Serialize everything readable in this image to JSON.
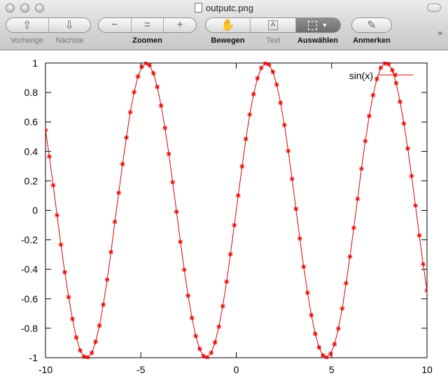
{
  "window": {
    "title": "outputc.png"
  },
  "toolbar": {
    "prev_label": "Vorherige",
    "next_label": "Nächste",
    "zoom_label": "Zoomen",
    "move_label": "Bewegen",
    "text_label": "Text",
    "select_label": "Auswählen",
    "annotate_label": "Anmerken",
    "overflow": "»"
  },
  "chart_data": {
    "type": "line",
    "function": "sin(x)",
    "x": [
      -10.0,
      -9.798,
      -9.596,
      -9.394,
      -9.192,
      -8.99,
      -8.788,
      -8.586,
      -8.384,
      -8.182,
      -7.98,
      -7.778,
      -7.576,
      -7.374,
      -7.172,
      -6.97,
      -6.768,
      -6.566,
      -6.364,
      -6.162,
      -5.96,
      -5.758,
      -5.556,
      -5.354,
      -5.152,
      -4.949,
      -4.747,
      -4.545,
      -4.343,
      -4.141,
      -3.939,
      -3.737,
      -3.535,
      -3.333,
      -3.131,
      -2.929,
      -2.727,
      -2.525,
      -2.323,
      -2.121,
      -1.919,
      -1.717,
      -1.515,
      -1.313,
      -1.111,
      -0.909,
      -0.707,
      -0.505,
      -0.303,
      -0.101,
      0.101,
      0.303,
      0.505,
      0.707,
      0.909,
      1.111,
      1.313,
      1.515,
      1.717,
      1.919,
      2.121,
      2.323,
      2.525,
      2.727,
      2.929,
      3.131,
      3.333,
      3.535,
      3.737,
      3.939,
      4.141,
      4.343,
      4.545,
      4.747,
      4.949,
      5.152,
      5.354,
      5.556,
      5.758,
      5.96,
      6.162,
      6.364,
      6.566,
      6.768,
      6.97,
      7.172,
      7.374,
      7.576,
      7.778,
      7.98,
      8.182,
      8.384,
      8.586,
      8.788,
      8.99,
      9.192,
      9.394,
      9.596,
      9.798,
      10.0
    ],
    "y": [
      0.544,
      0.365,
      0.17,
      -0.033,
      -0.233,
      -0.42,
      -0.589,
      -0.737,
      -0.863,
      -0.951,
      -0.993,
      -0.998,
      -0.968,
      -0.892,
      -0.782,
      -0.64,
      -0.47,
      -0.283,
      -0.078,
      0.119,
      0.314,
      0.494,
      0.666,
      0.802,
      0.908,
      0.974,
      0.999,
      0.985,
      0.93,
      0.838,
      0.711,
      0.559,
      0.383,
      0.191,
      -0.01,
      -0.213,
      -0.403,
      -0.579,
      -0.73,
      -0.853,
      -0.94,
      -0.989,
      -0.998,
      -0.967,
      -0.896,
      -0.789,
      -0.65,
      -0.484,
      -0.298,
      -0.101,
      0.101,
      0.298,
      0.484,
      0.65,
      0.789,
      0.896,
      0.967,
      0.998,
      0.989,
      0.94,
      0.853,
      0.73,
      0.579,
      0.403,
      0.213,
      0.01,
      -0.191,
      -0.383,
      -0.559,
      -0.711,
      -0.838,
      -0.93,
      -0.985,
      -0.999,
      -0.974,
      -0.908,
      -0.802,
      -0.666,
      -0.494,
      -0.314,
      -0.119,
      0.078,
      0.283,
      0.47,
      0.64,
      0.782,
      0.892,
      0.968,
      0.998,
      0.993,
      0.951,
      0.863,
      0.737,
      0.589,
      0.42,
      0.233,
      0.033,
      -0.17,
      -0.365,
      -0.544
    ],
    "xlim": [
      -10,
      10
    ],
    "ylim": [
      -1,
      1
    ],
    "x_ticks": [
      -10,
      -5,
      0,
      5,
      10
    ],
    "x_tick_labels": [
      "-10",
      "-5",
      "0",
      "5",
      "10"
    ],
    "y_ticks": [
      -1,
      -0.8,
      -0.6,
      -0.4,
      -0.2,
      0,
      0.2,
      0.4,
      0.6,
      0.8,
      1
    ],
    "y_tick_labels": [
      "-1",
      "-0.8",
      "-0.6",
      "-0.4",
      "-0.2",
      "0",
      "0.2",
      "0.4",
      "0.6",
      "0.8",
      "1"
    ],
    "title": "",
    "xlabel": "",
    "ylabel": "",
    "legend": {
      "entries": [
        "sin(x)"
      ],
      "placement": "top-right"
    },
    "marker": "star",
    "color": "#e00000",
    "grid": false
  }
}
